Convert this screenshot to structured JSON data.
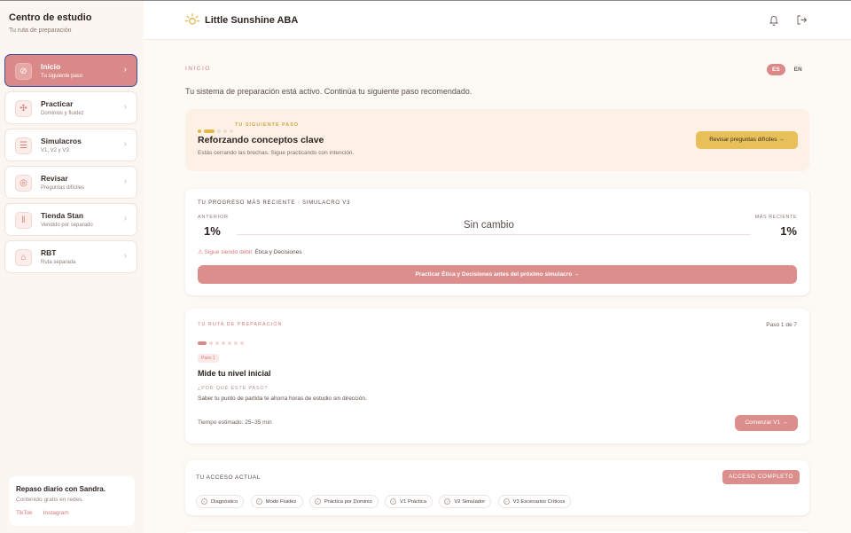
{
  "sidebar": {
    "title": "Centro de estudio",
    "subtitle": "Tu ruta de preparación",
    "items": [
      {
        "label": "Inicio",
        "sub": "Tu siguiente paso",
        "icon": "compass-icon",
        "active": true
      },
      {
        "label": "Practicar",
        "sub": "Dominios y fluidez",
        "icon": "puzzle-icon",
        "active": false
      },
      {
        "label": "Simulacros",
        "sub": "V1, V2 y V3",
        "icon": "scroll-icon",
        "active": false
      },
      {
        "label": "Revisar",
        "sub": "Preguntas difíciles",
        "icon": "target-icon",
        "active": false
      },
      {
        "label": "Tienda Stan",
        "sub": "Vendido por separado",
        "icon": "books-icon",
        "active": false
      },
      {
        "label": "RBT",
        "sub": "Ruta separada",
        "icon": "graduation-cap-icon",
        "active": false
      }
    ],
    "promo": {
      "title": "Repaso diario con Sandra.",
      "text": "Contenido gratis en redes.",
      "links": [
        "TikTok",
        "Instagram"
      ]
    }
  },
  "header": {
    "brand": "Little Sunshine ABA",
    "icons": [
      "sun-icon",
      "bell-icon",
      "logout-icon"
    ]
  },
  "main": {
    "breadcrumb": "INICIO",
    "lang": {
      "active": "ES",
      "other": "EN"
    },
    "lead": "Tu sistema de preparación está activo. Continúa tu siguiente paso recomendado.",
    "next_step": {
      "eyebrow": "TU SIGUIENTE PASO",
      "title": "Reforzando conceptos clave",
      "desc": "Estás cerrando las brechas. Sigue practicando con intención.",
      "button": "Revisar preguntas difíciles →"
    },
    "progress": {
      "eyebrow": "TU PROGRESO MÁS RECIENTE · SIMULACRO V3",
      "prev_label": "ANTERIOR",
      "prev_value": "1%",
      "change": "Sin cambio",
      "recent_label": "MÁS RECIENTE",
      "recent_value": "1%",
      "weak_label": "⚠ Sigue siendo débil:",
      "weak_value": "Ética y Decisiones",
      "button": "Practicar Ética y Decisiones antes del próximo simulacro →"
    },
    "route": {
      "eyebrow": "TU RUTA DE PREPARACIÓN",
      "step_counter": "Paso 1 de 7",
      "current_step": 1,
      "total_steps": 7,
      "badge": "Paso 1",
      "title": "Mide tu nivel inicial",
      "why_label": "¿POR QUÉ ESTE PASO?",
      "why_text": "Saber tu punto de partida te ahorra horas de estudio sin dirección.",
      "time": "Tiempo estimado: 25–35 min",
      "button": "Comenzar V1 →"
    },
    "access": {
      "eyebrow": "TU ACCESO ACTUAL",
      "badge": "ACCESO COMPLETO",
      "chips": [
        "Diagnóstico",
        "Modo Fluidez",
        "Práctica por Dominio",
        "V1 Práctica",
        "V2 Simulador",
        "V3 Escenarios Críticos"
      ]
    }
  },
  "colors": {
    "accent": "#d98a88",
    "gold": "#e7c05a",
    "active_border": "#3a4ea0",
    "bg": "#fdfaf6"
  }
}
